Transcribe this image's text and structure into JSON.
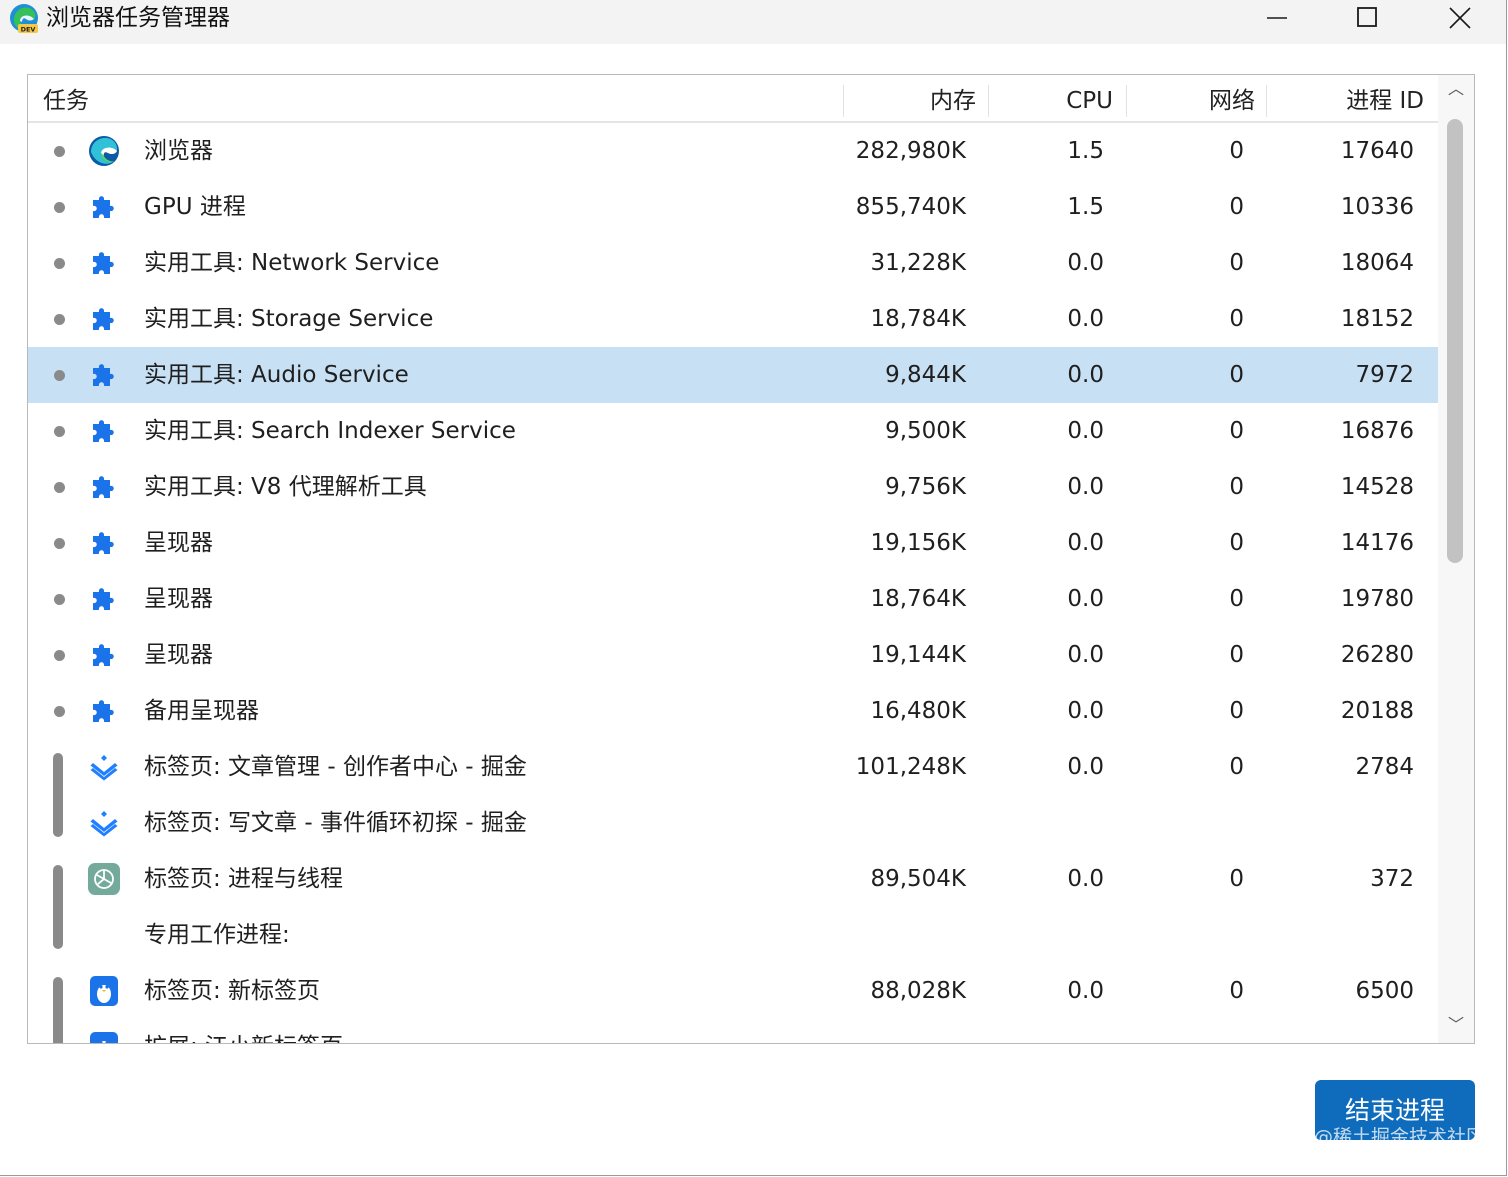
{
  "window": {
    "title": "浏览器任务管理器",
    "app_icon": "edge-dev-icon",
    "controls": [
      "minimize-icon",
      "maximize-icon",
      "close-icon"
    ]
  },
  "table": {
    "columns": [
      "任务",
      "内存",
      "CPU",
      "网络",
      "进程 ID"
    ],
    "rows": [
      {
        "icon": "edge-icon",
        "task": "浏览器",
        "memory": "282,980K",
        "cpu": "1.5",
        "network": "0",
        "pid": "17640"
      },
      {
        "icon": "puzzle-icon",
        "task": "GPU 进程",
        "memory": "855,740K",
        "cpu": "1.5",
        "network": "0",
        "pid": "10336"
      },
      {
        "icon": "puzzle-icon",
        "task": "实用工具: Network Service",
        "memory": "31,228K",
        "cpu": "0.0",
        "network": "0",
        "pid": "18064"
      },
      {
        "icon": "puzzle-icon",
        "task": "实用工具: Storage Service",
        "memory": "18,784K",
        "cpu": "0.0",
        "network": "0",
        "pid": "18152"
      },
      {
        "icon": "puzzle-icon",
        "task": "实用工具: Audio Service",
        "memory": "9,844K",
        "cpu": "0.0",
        "network": "0",
        "pid": "7972",
        "selected": true
      },
      {
        "icon": "puzzle-icon",
        "task": "实用工具: Search Indexer Service",
        "memory": "9,500K",
        "cpu": "0.0",
        "network": "0",
        "pid": "16876"
      },
      {
        "icon": "puzzle-icon",
        "task": "实用工具: V8 代理解析工具",
        "memory": "9,756K",
        "cpu": "0.0",
        "network": "0",
        "pid": "14528"
      },
      {
        "icon": "puzzle-icon",
        "task": "呈现器",
        "memory": "19,156K",
        "cpu": "0.0",
        "network": "0",
        "pid": "14176"
      },
      {
        "icon": "puzzle-icon",
        "task": "呈现器",
        "memory": "18,764K",
        "cpu": "0.0",
        "network": "0",
        "pid": "19780"
      },
      {
        "icon": "puzzle-icon",
        "task": "呈现器",
        "memory": "19,144K",
        "cpu": "0.0",
        "network": "0",
        "pid": "26280"
      },
      {
        "icon": "puzzle-icon",
        "task": "备用呈现器",
        "memory": "16,480K",
        "cpu": "0.0",
        "network": "0",
        "pid": "20188"
      },
      {
        "icon": "juejin-icon",
        "task": "标签页: 文章管理 - 创作者中心 - 掘金",
        "memory": "101,248K",
        "cpu": "0.0",
        "network": "0",
        "pid": "2784"
      },
      {
        "icon": "juejin-icon",
        "task": "标签页: 写文章 - 事件循环初探 - 掘金",
        "memory": "",
        "cpu": "",
        "network": "",
        "pid": ""
      },
      {
        "icon": "openai-icon",
        "task": "标签页: 进程与线程",
        "memory": "89,504K",
        "cpu": "0.0",
        "network": "0",
        "pid": "372"
      },
      {
        "icon": "",
        "task": "专用工作进程:",
        "memory": "",
        "cpu": "",
        "network": "",
        "pid": ""
      },
      {
        "icon": "penguin-icon",
        "task": "标签页: 新标签页",
        "memory": "88,028K",
        "cpu": "0.0",
        "network": "0",
        "pid": "6500"
      },
      {
        "icon": "penguin-icon",
        "task": "扩展: 江小新标签页",
        "memory": "",
        "cpu": "",
        "network": "",
        "pid": ""
      }
    ]
  },
  "footer": {
    "end_process_label": "结束进程",
    "watermark": "@稀土掘金技术社区"
  },
  "colors": {
    "selected_row": "#c7e0f4",
    "accent_button": "#0f6cbd",
    "puzzle_icon": "#1a73e8"
  }
}
